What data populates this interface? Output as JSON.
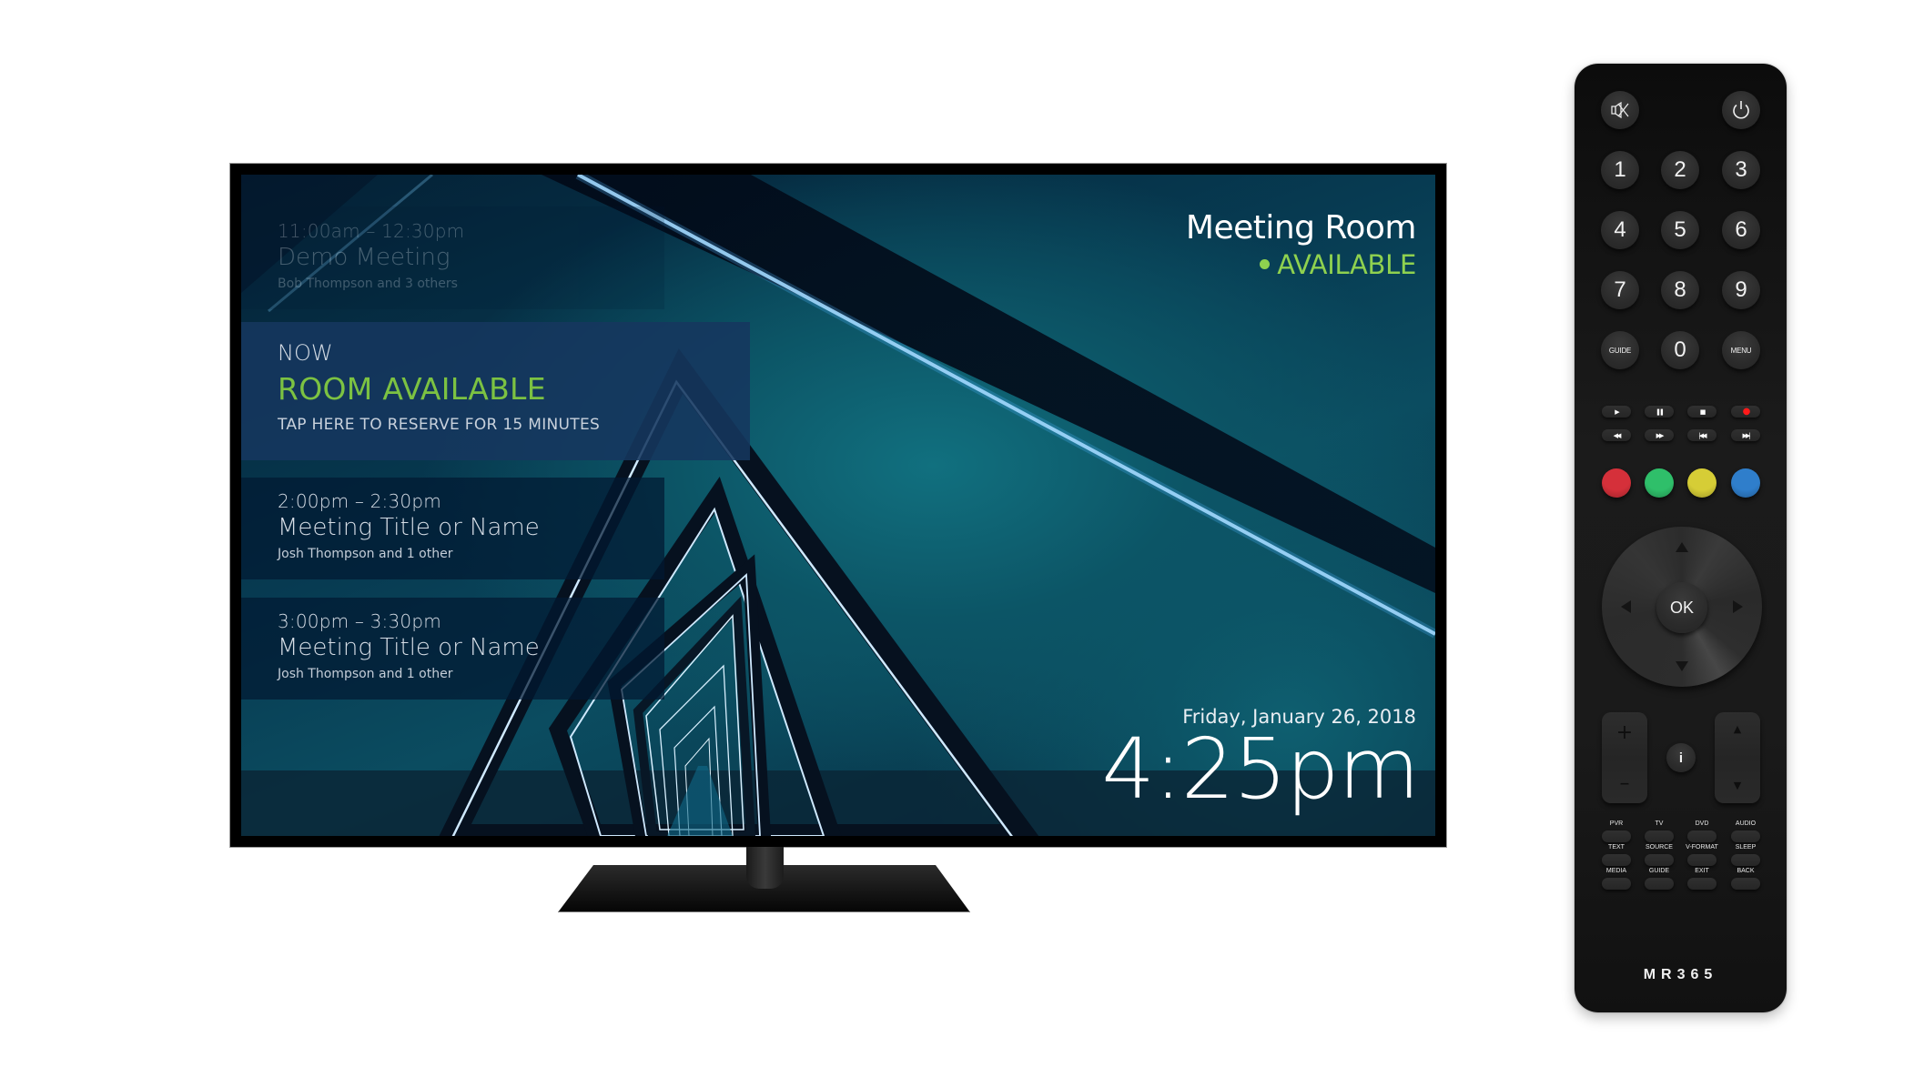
{
  "tv": {
    "room": {
      "name": "Meeting Room",
      "status": "AVAILABLE",
      "status_color": "#8fd14f"
    },
    "schedule": {
      "past": {
        "time": "11:00am – 12:30pm",
        "title": "Demo Meeting",
        "attendees": "Bob Thompson and 3 others"
      },
      "now": {
        "label": "NOW",
        "status": "ROOM AVAILABLE",
        "action": "TAP HERE TO RESERVE FOR 15 MINUTES",
        "status_color": "#7cc242"
      },
      "upcoming": [
        {
          "time": "2:00pm – 2:30pm",
          "title": "Meeting Title or Name",
          "attendees": "Josh Thompson and 1 other"
        },
        {
          "time": "3:00pm – 3:30pm",
          "title": "Meeting Title or Name",
          "attendees": "Josh Thompson and 1 other"
        }
      ]
    },
    "date": "Friday, January 26, 2018",
    "clock": "4:25pm"
  },
  "remote": {
    "top": {
      "mute_icon": "mute-icon",
      "power_icon": "power-icon"
    },
    "keypad": [
      "1",
      "2",
      "3",
      "4",
      "5",
      "6",
      "7",
      "8",
      "9",
      "GUIDE",
      "0",
      "MENU"
    ],
    "transport": [
      {
        "icon": "play-icon",
        "glyph": "▶"
      },
      {
        "icon": "pause-icon",
        "glyph": "❚❚"
      },
      {
        "icon": "stop-icon",
        "glyph": "■"
      },
      {
        "icon": "record-icon",
        "glyph": "●",
        "color": "#ff1a1a"
      },
      {
        "icon": "rewind-icon",
        "glyph": "◀◀"
      },
      {
        "icon": "fast-forward-icon",
        "glyph": "▶▶"
      },
      {
        "icon": "previous-track-icon",
        "glyph": "|◀◀"
      },
      {
        "icon": "next-track-icon",
        "glyph": "▶▶|"
      }
    ],
    "color_keys": [
      {
        "name": "red",
        "color": "#d5303a"
      },
      {
        "name": "green",
        "color": "#2fbf6a"
      },
      {
        "name": "yellow",
        "color": "#d6cd36"
      },
      {
        "name": "blue",
        "color": "#2f7ecb"
      }
    ],
    "ok_label": "OK",
    "info_label": "i",
    "volume": {
      "up": "+",
      "down": "–"
    },
    "channel": {
      "up": "▲",
      "down": "▼"
    },
    "source_keys": [
      "PVR",
      "TV",
      "DVD",
      "AUDIO",
      "TEXT",
      "SOURCE",
      "V-FORMAT",
      "SLEEP",
      "MEDIA",
      "GUIDE",
      "EXIT",
      "BACK"
    ],
    "brand": "MR365"
  }
}
